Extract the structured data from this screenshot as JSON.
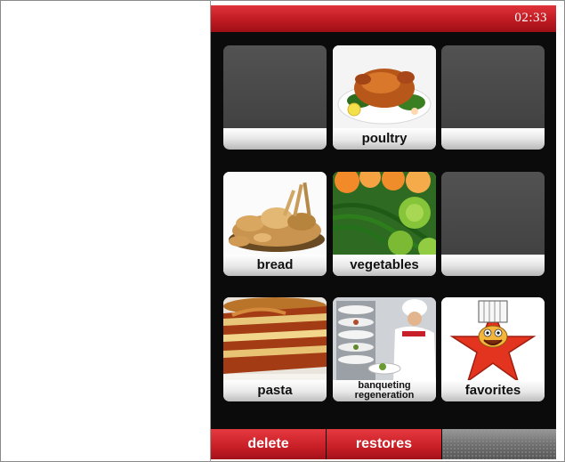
{
  "status": {
    "time": "02:33"
  },
  "tiles": [
    {
      "label": "",
      "icon": "empty-slot"
    },
    {
      "label": "poultry",
      "icon": "roast-chicken-photo"
    },
    {
      "label": "",
      "icon": "empty-slot"
    },
    {
      "label": "bread",
      "icon": "bread-basket-photo"
    },
    {
      "label": "vegetables",
      "icon": "vegetables-photo"
    },
    {
      "label": "",
      "icon": "empty-slot"
    },
    {
      "label": "pasta",
      "icon": "lasagna-photo"
    },
    {
      "label_line1": "banqueting",
      "label_line2": "regeneration",
      "icon": "chef-plates-photo"
    },
    {
      "label": "favorites",
      "icon": "chef-star-icon"
    }
  ],
  "actions": {
    "delete": "delete",
    "restores": "restores"
  },
  "colors": {
    "accent": "#c81e26",
    "background": "#0b0b0b",
    "tile_empty": "#4a4a4a"
  }
}
